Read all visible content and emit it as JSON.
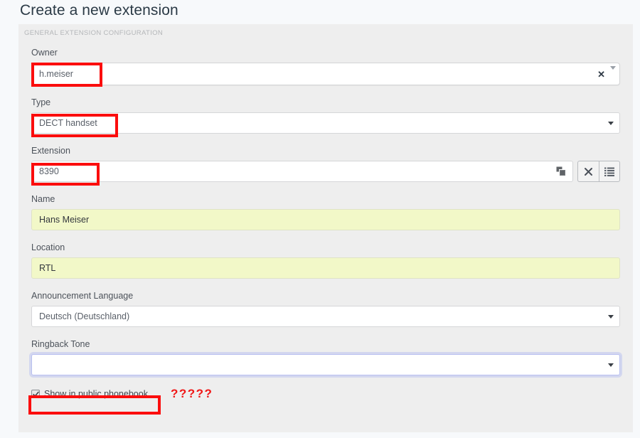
{
  "page": {
    "title": "Create a new extension",
    "background_color": "#f7f9fb"
  },
  "panel": {
    "legend": "GENERAL EXTENSION CONFIGURATION",
    "background_color": "#eeeeee"
  },
  "fields": {
    "owner": {
      "label": "Owner",
      "value": "h.meiser",
      "clear_glyph": "✕",
      "has_clear_button": true,
      "has_dropdown_caret": true
    },
    "type": {
      "label": "Type",
      "value": "DECT handset",
      "has_dropdown_caret": true
    },
    "extension": {
      "label": "Extension",
      "value": "8390",
      "inline_icon_name": "multi-device-icon",
      "buttons": [
        {
          "name": "clear-extension-button",
          "glyph": "✕"
        },
        {
          "name": "extension-list-button",
          "glyph": "list"
        }
      ]
    },
    "name": {
      "label": "Name",
      "value": "Hans Meiser",
      "autofilled": true
    },
    "location": {
      "label": "Location",
      "value": "RTL",
      "autofilled": true
    },
    "announcement_language": {
      "label": "Announcement Language",
      "value": "Deutsch (Deutschland)",
      "has_dropdown_caret": true
    },
    "ringback_tone": {
      "label": "Ringback Tone",
      "value": "",
      "focused": true,
      "has_dropdown_caret": true
    },
    "show_in_public_phonebook": {
      "label": "Show in public phonebook",
      "checked": true
    }
  },
  "annotations": {
    "question_marks": "?????",
    "highlight_color": "#fb0d0d",
    "autofill_color": "#f2f8c8",
    "focus_color": "#b9c0f0"
  }
}
